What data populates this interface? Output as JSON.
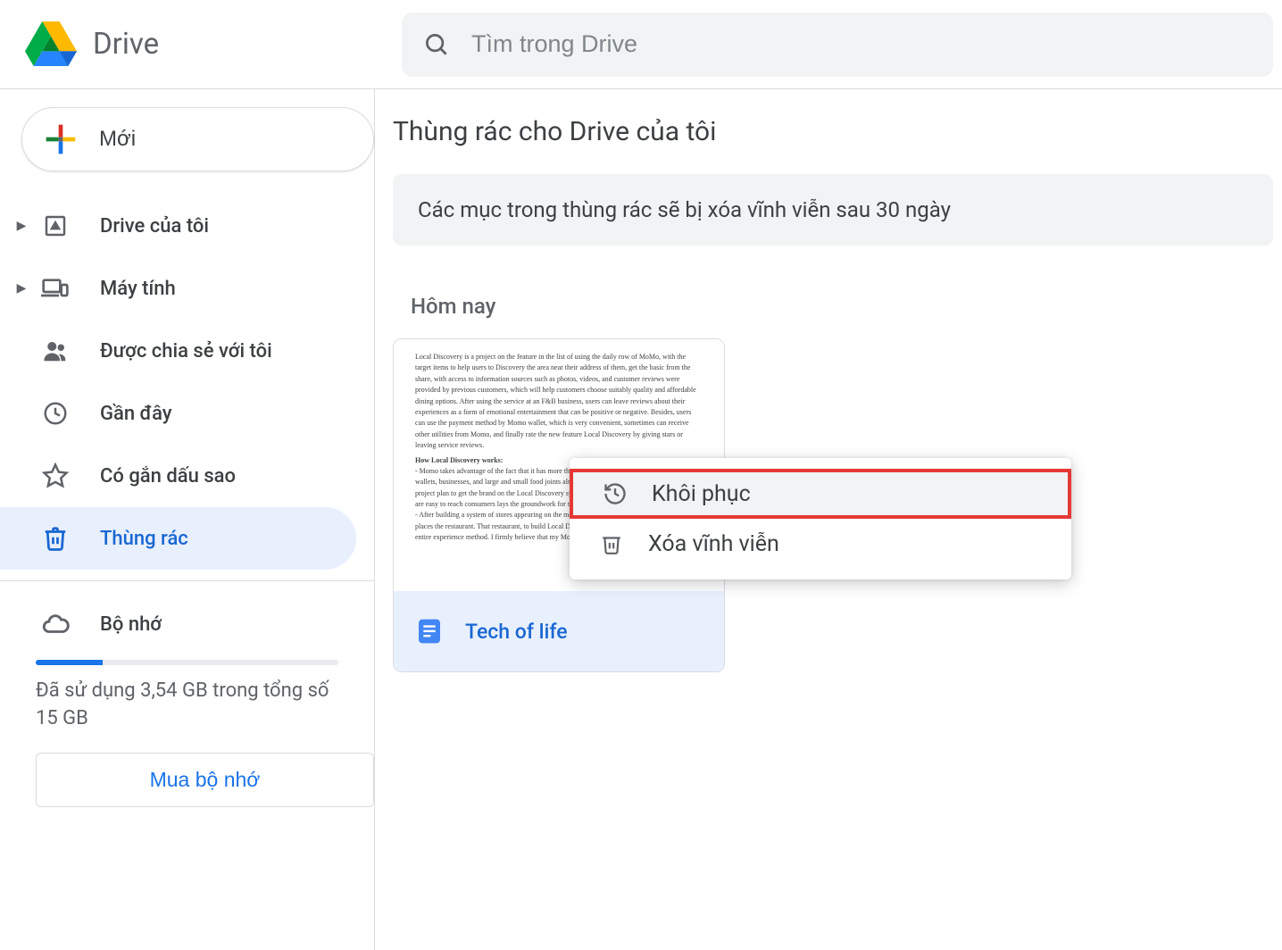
{
  "app_name": "Drive",
  "search": {
    "placeholder": "Tìm trong Drive"
  },
  "new_button": "Mới",
  "sidebar": {
    "items": [
      {
        "label": "Drive của tôi",
        "has_expand": true
      },
      {
        "label": "Máy tính",
        "has_expand": true
      },
      {
        "label": "Được chia sẻ với tôi",
        "has_expand": false
      },
      {
        "label": "Gần đây",
        "has_expand": false
      },
      {
        "label": "Có gắn dấu sao",
        "has_expand": false
      },
      {
        "label": "Thùng rác",
        "has_expand": false
      }
    ],
    "storage_label": "Bộ nhớ",
    "storage_text": "Đã sử dụng 3,54 GB trong tổng số 15 GB",
    "buy_storage": "Mua bộ nhớ"
  },
  "content": {
    "title": "Thùng rác cho Drive của tôi",
    "banner": "Các mục trong thùng rác sẽ bị xóa vĩnh viễn sau 30 ngày",
    "section": "Hôm nay",
    "file": {
      "name": "Tech of life",
      "preview": "Local Discovery is a project on the feature in the list of using the daily row of MoMo, with the target items to help users to Discovery the area near their address of them, get the basic from the share, with access to information sources such as photos, videos, and customer reviews were provided by previous customers, which will help customers choose suitably quality and affordable dining options. After using the service at an F&B business, users can leave reviews about their experiences as a form of emotional entertainment that can be positive or negative. Besides, users can use the payment method by Momo wallet, which is very convenient, sometimes can receive other utilities from Momo, and finally rate the new feature Local Discovery by giving stars or leaving service reviews."
    }
  },
  "context_menu": {
    "restore": "Khôi phục",
    "delete": "Xóa vĩnh viễn"
  }
}
